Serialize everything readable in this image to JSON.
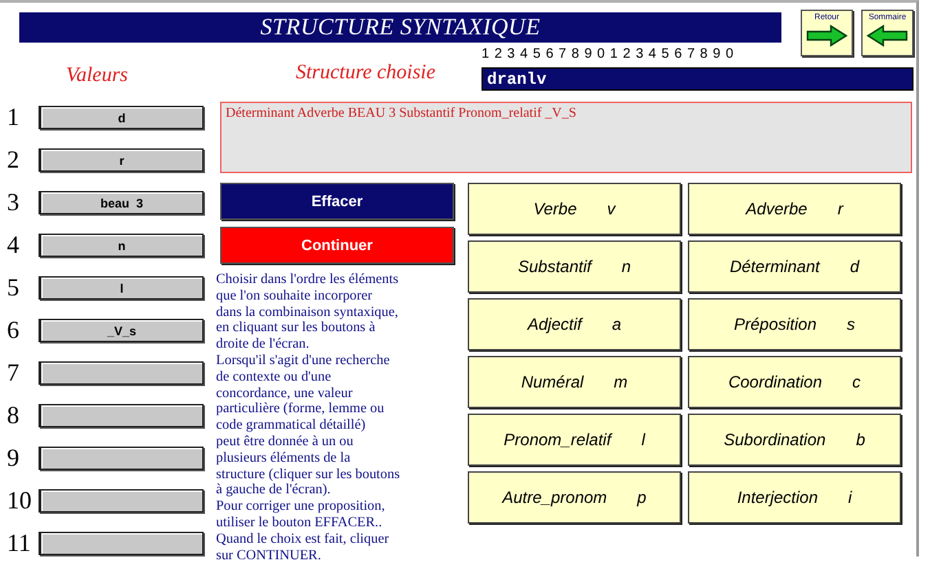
{
  "header": {
    "title": "STRUCTURE SYNTAXIQUE"
  },
  "nav_buttons": [
    {
      "label": "Retour",
      "kind": "forward"
    },
    {
      "label": "Sommaire",
      "kind": "back"
    }
  ],
  "ruler": "1 2 3 4 5 6 7 8 9 0 1 2 3 4 5 6 7 8 9 0",
  "values_label": "Valeurs",
  "structure_label": "Structure choisie",
  "structure_value": "dranlv",
  "description": "Déterminant Adverbe BEAU 3 Substantif Pronom_relatif _V_S",
  "slots": [
    {
      "number": "1",
      "value": "d"
    },
    {
      "number": "2",
      "value": "r"
    },
    {
      "number": "3",
      "value": "beau  3"
    },
    {
      "number": "4",
      "value": "n"
    },
    {
      "number": "5",
      "value": "l"
    },
    {
      "number": "6",
      "value": "_V_s"
    },
    {
      "number": "7"
    },
    {
      "number": "8"
    },
    {
      "number": "9"
    },
    {
      "number": "10"
    },
    {
      "number": "11"
    }
  ],
  "actions": [
    {
      "label": "Effacer",
      "kind": "clear"
    },
    {
      "label": "Continuer",
      "kind": "continue"
    }
  ],
  "instructions": [
    "Choisir dans l'ordre les éléments",
    "que l'on souhaite incorporer",
    "dans la combinaison syntaxique,",
    "en cliquant sur les boutons à",
    "droite de l'écran.",
    "Lorsqu'il s'agit d'une recherche",
    "de contexte ou d'une",
    "concordance, une valeur",
    "particulière (forme, lemme ou",
    "code grammatical détaillé)",
    "peut être donnée à un ou",
    "plusieurs éléments de la",
    "structure (cliquer sur les boutons",
    "à gauche de l'écran).",
    "Pour corriger une proposition,",
    "utiliser le bouton EFFACER..",
    "Quand le choix est fait, cliquer",
    "sur CONTINUER."
  ],
  "categories": [
    {
      "label": "Verbe",
      "code": "v"
    },
    {
      "label": "Adverbe",
      "code": "r"
    },
    {
      "label": "Substantif",
      "code": "n"
    },
    {
      "label": "Déterminant",
      "code": "d"
    },
    {
      "label": "Adjectif",
      "code": "a"
    },
    {
      "label": "Préposition",
      "code": "s"
    },
    {
      "label": "Numéral",
      "code": "m"
    },
    {
      "label": "Coordination",
      "code": "c"
    },
    {
      "label": "Pronom_relatif",
      "code": "l"
    },
    {
      "label": "Subordination",
      "code": "b"
    },
    {
      "label": "Autre_pronom",
      "code": "p"
    },
    {
      "label": "Interjection",
      "code": "i"
    }
  ]
}
